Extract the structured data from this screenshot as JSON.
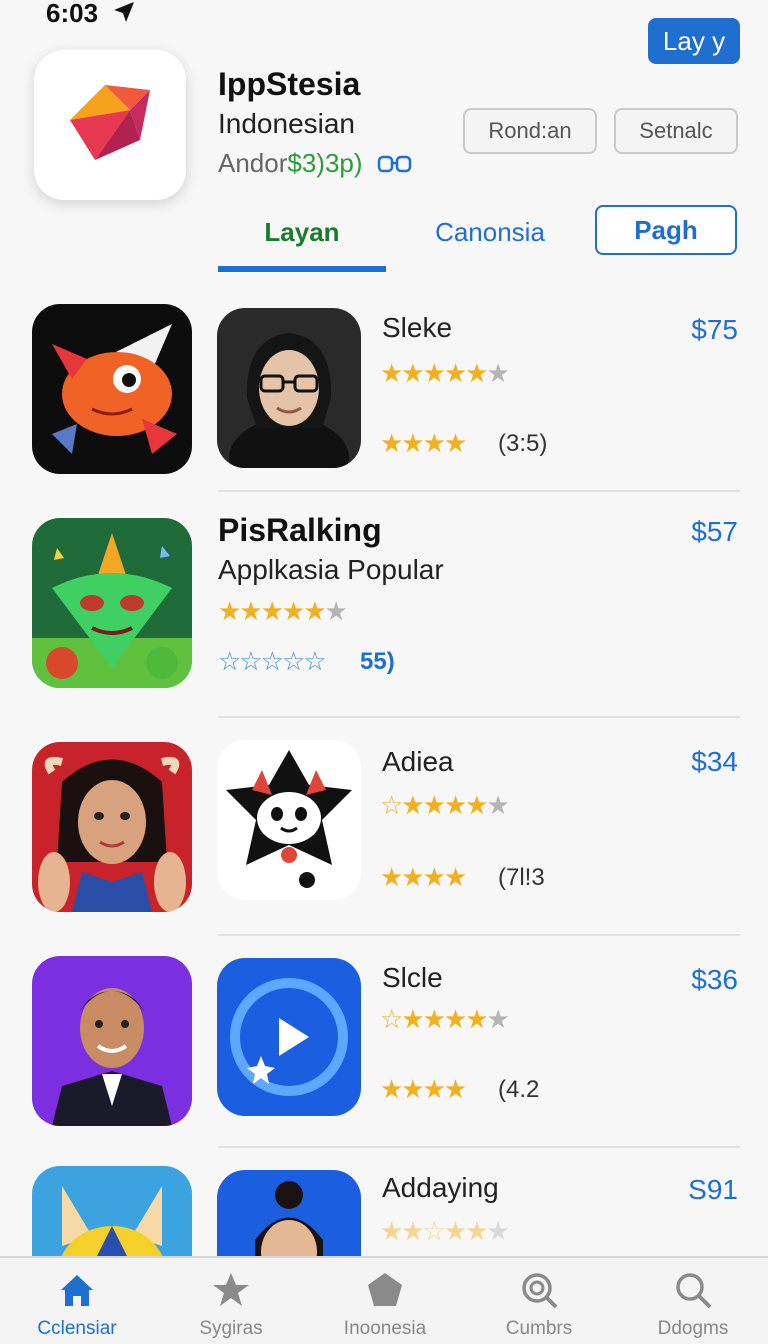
{
  "status_bar": {
    "time": "6:03"
  },
  "header": {
    "top_button": "Lay y",
    "app_title": "IppStesia",
    "app_subtitle": "Indonesian",
    "meta_prefix": "Andor ",
    "meta_price": "$3)3p)",
    "buttons": [
      "Rond:an",
      "Setnalc"
    ]
  },
  "tabs": [
    {
      "label": "Layan"
    },
    {
      "label": "Canonsia"
    },
    {
      "label": "Pagh"
    }
  ],
  "rows": [
    {
      "name": "Sleke",
      "price": "$75",
      "count": "(3:5)"
    },
    {
      "name": "PisRalking",
      "subtitle": "Applkasia Popular",
      "price": "$57",
      "count": "55)"
    },
    {
      "name": "Adiea",
      "price": "$34",
      "count": "(7l!3"
    },
    {
      "name": "Slcle",
      "price": "$36",
      "count": "(4.2"
    },
    {
      "name": "Addaying",
      "price": "S91"
    }
  ],
  "bottom_nav": [
    {
      "label": "Cclensiar",
      "icon": "home-icon",
      "active": true
    },
    {
      "label": "Sygiras",
      "icon": "star-icon"
    },
    {
      "label": "Inoonesia",
      "icon": "pentagon-icon"
    },
    {
      "label": "Cumbrs",
      "icon": "magnifier-icon"
    },
    {
      "label": "Ddogms",
      "icon": "search-icon"
    }
  ],
  "colors": {
    "accent": "#1f6fd1",
    "green": "#1b7a2e",
    "star": "#f2b01e"
  }
}
